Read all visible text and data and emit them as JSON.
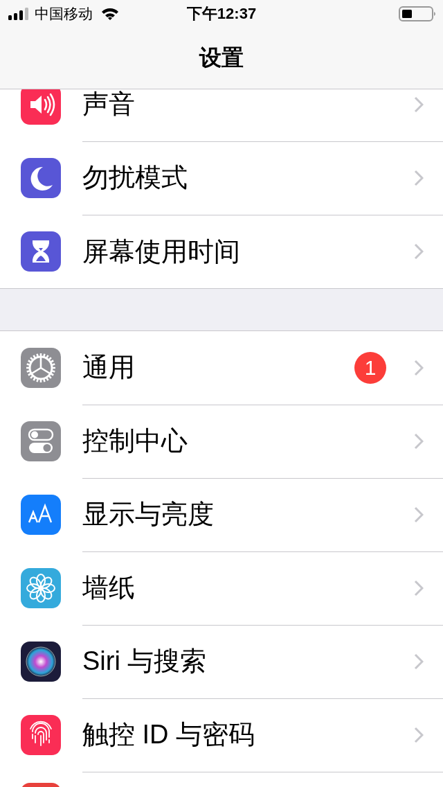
{
  "status_bar": {
    "carrier": "中国移动",
    "time": "下午12:37"
  },
  "nav_bar": {
    "title": "设置"
  },
  "groups": [
    {
      "items": [
        {
          "kind": "sound",
          "color": "#fa2d55",
          "label": "声音"
        },
        {
          "kind": "moon",
          "color": "#5856d6",
          "label": "勿扰模式"
        },
        {
          "kind": "hourglass",
          "color": "#5856d6",
          "label": "屏幕使用时间"
        }
      ]
    },
    {
      "items": [
        {
          "kind": "gear",
          "color": "#8e8e93",
          "label": "通用",
          "badge": "1"
        },
        {
          "kind": "toggles",
          "color": "#8e8e93",
          "label": "控制中心"
        },
        {
          "kind": "text-size",
          "color": "#147efb",
          "label": "显示与亮度"
        },
        {
          "kind": "flower",
          "color": "#34aadc",
          "label": "墙纸"
        },
        {
          "kind": "siri",
          "color": "#1c1c3a",
          "label": "Siri 与搜索"
        },
        {
          "kind": "fingerprint",
          "color": "#fa2d55",
          "label": "触控 ID 与密码"
        },
        {
          "kind": "plain",
          "color": "#e8413c"
        }
      ]
    }
  ]
}
